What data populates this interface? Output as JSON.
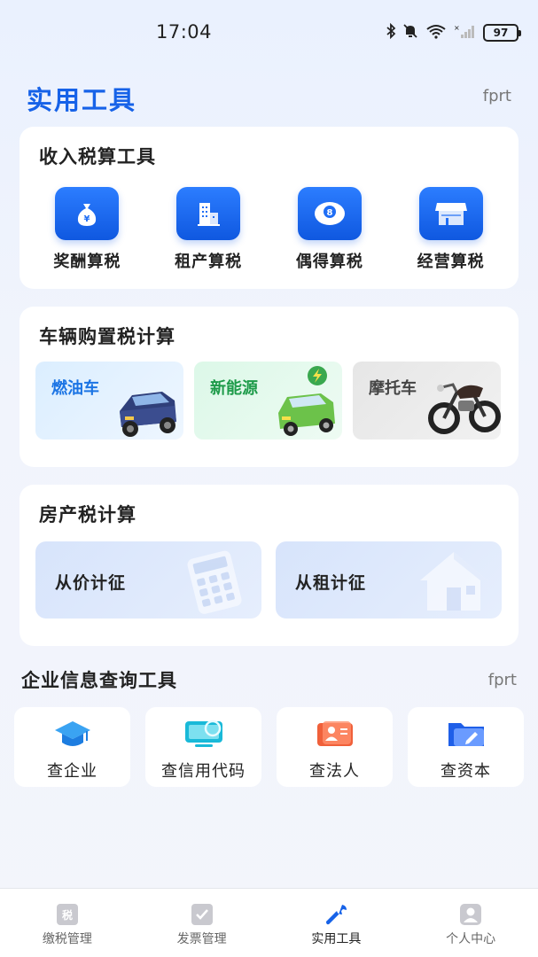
{
  "status_bar": {
    "time": "17:04",
    "battery": "97",
    "icons": [
      "bluetooth-icon",
      "mute-bell-icon",
      "wifi-icon",
      "signal-icon",
      "battery-icon"
    ]
  },
  "header": {
    "title": "实用工具",
    "tag": "fprt"
  },
  "income_tools": {
    "title": "收入税算工具",
    "items": [
      {
        "label": "奖酬算税",
        "icon": "money-bag-icon"
      },
      {
        "label": "租产算税",
        "icon": "building-icon"
      },
      {
        "label": "偶得算税",
        "icon": "lottery-ball-icon"
      },
      {
        "label": "经营算税",
        "icon": "shop-icon"
      }
    ]
  },
  "vehicle_tax": {
    "title": "车辆购置税计算",
    "items": [
      {
        "label": "燃油车",
        "icon": "pickup-truck-icon"
      },
      {
        "label": "新能源",
        "icon": "electric-car-icon"
      },
      {
        "label": "摩托车",
        "icon": "motorcycle-icon"
      }
    ]
  },
  "property_tax": {
    "title": "房产税计算",
    "items": [
      {
        "label": "从价计征",
        "icon": "calculator-icon"
      },
      {
        "label": "从租计征",
        "icon": "house-icon"
      }
    ]
  },
  "enterprise_query": {
    "title": "企业信息查询工具",
    "tag": "fprt",
    "items": [
      {
        "label": "查企业",
        "icon": "graduation-cap-icon"
      },
      {
        "label": "查信用代码",
        "icon": "monitor-icon"
      },
      {
        "label": "查法人",
        "icon": "id-card-icon"
      },
      {
        "label": "查资本",
        "icon": "folder-icon"
      }
    ]
  },
  "bottom_nav": {
    "items": [
      {
        "label": "缴税管理",
        "icon": "tax-receipt-icon",
        "active": false
      },
      {
        "label": "发票管理",
        "icon": "invoice-icon",
        "active": false
      },
      {
        "label": "实用工具",
        "icon": "wrench-icon",
        "active": true
      },
      {
        "label": "个人中心",
        "icon": "person-icon",
        "active": false
      }
    ]
  },
  "colors": {
    "accent": "#1662e8",
    "icon_blue": "#1f6ef5",
    "background": "#eef2fc"
  }
}
